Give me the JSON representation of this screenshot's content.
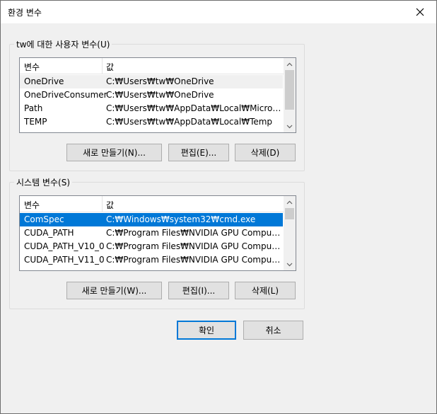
{
  "window": {
    "title": "환경 변수",
    "close_icon": "close-icon"
  },
  "user_vars": {
    "legend": "tw에 대한 사용자 변수(U)",
    "col_variable": "변수",
    "col_value": "값",
    "rows": [
      {
        "name": "OneDrive",
        "value": "C:₩Users₩tw₩OneDrive"
      },
      {
        "name": "OneDriveConsumer",
        "value": "C:₩Users₩tw₩OneDrive"
      },
      {
        "name": "Path",
        "value": "C:₩Users₩tw₩AppData₩Local₩Microsoft₩..."
      },
      {
        "name": "TEMP",
        "value": "C:₩Users₩tw₩AppData₩Local₩Temp"
      }
    ],
    "new_button": "새로 만들기(N)...",
    "edit_button": "편집(E)...",
    "delete_button": "삭제(D)"
  },
  "system_vars": {
    "legend": "시스템 변수(S)",
    "col_variable": "변수",
    "col_value": "값",
    "rows": [
      {
        "name": "ComSpec",
        "value": "C:₩Windows₩system32₩cmd.exe"
      },
      {
        "name": "CUDA_PATH",
        "value": "C:₩Program Files₩NVIDIA GPU Computing..."
      },
      {
        "name": "CUDA_PATH_V10_0",
        "value": "C:₩Program Files₩NVIDIA GPU Computing..."
      },
      {
        "name": "CUDA_PATH_V11_0",
        "value": "C:₩Program Files₩NVIDIA GPU Computing..."
      }
    ],
    "new_button": "새로 만들기(W)...",
    "edit_button": "편집(I)...",
    "delete_button": "삭제(L)"
  },
  "footer": {
    "ok_button": "확인",
    "cancel_button": "취소"
  },
  "colors": {
    "selection": "#0078d7",
    "default_button_border": "#0078d7",
    "dialog_bg": "#f0f0f0"
  }
}
